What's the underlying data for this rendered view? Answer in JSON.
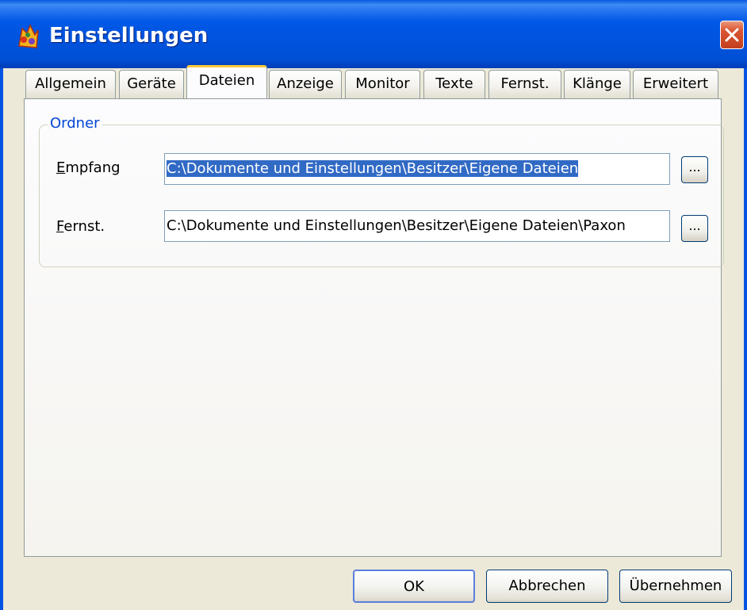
{
  "window": {
    "title": "Einstellungen",
    "icon": "app-icon",
    "close_icon": "close-icon"
  },
  "tabs": [
    {
      "label": "Allgemein"
    },
    {
      "label": "Geräte"
    },
    {
      "label": "Dateien",
      "active": true
    },
    {
      "label": "Anzeige"
    },
    {
      "label": "Monitor"
    },
    {
      "label": "Texte"
    },
    {
      "label": "Fernst."
    },
    {
      "label": "Klänge"
    },
    {
      "label": "Erweitert"
    }
  ],
  "group": {
    "title": "Ordner",
    "rows": [
      {
        "label_mnemonic": "E",
        "label_rest": "mpfang",
        "value": "C:\\Dokumente und Einstellungen\\Besitzer\\Eigene Dateien",
        "selected": true,
        "browse_label": "..."
      },
      {
        "label_mnemonic": "F",
        "label_rest": "ernst.",
        "value": "C:\\Dokumente und Einstellungen\\Besitzer\\Eigene Dateien\\Paxon",
        "selected": false,
        "browse_label": "..."
      }
    ]
  },
  "buttons": {
    "ok": "OK",
    "cancel": "Abbrechen",
    "apply": "Übernehmen"
  },
  "colors": {
    "titlebar": "#0054E3",
    "active_tab_accent": "#FFC83C",
    "group_title": "#0046D5",
    "selection": "#316AC5",
    "close_button": "#DA5432"
  }
}
